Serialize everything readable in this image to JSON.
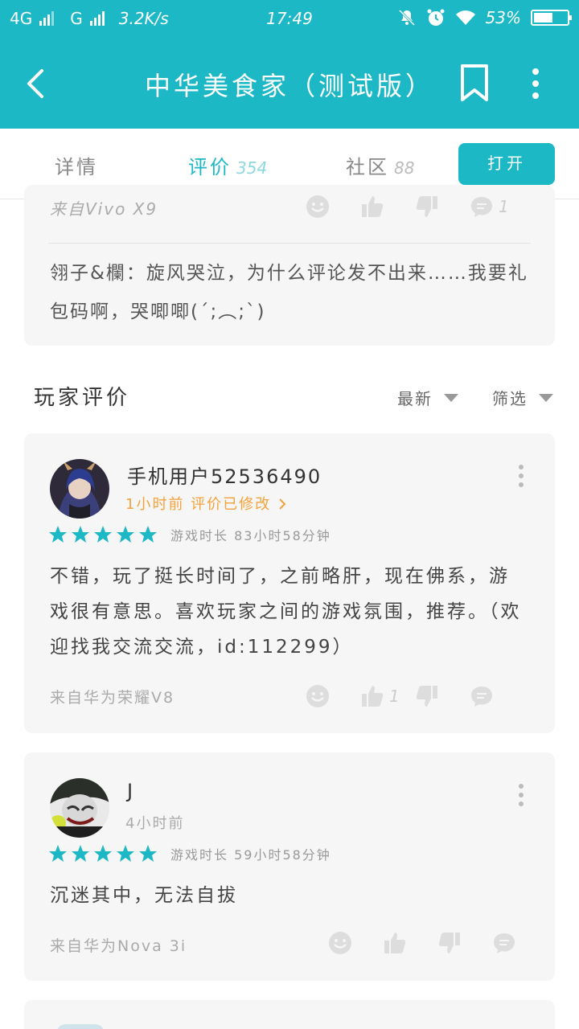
{
  "status_bar": {
    "network1": "4G",
    "network2": "G",
    "speed": "3.2K/s",
    "time": "17:49",
    "battery": "53%",
    "battery_level": 0.53
  },
  "app_bar": {
    "title": "中华美食家（测试版）"
  },
  "tabs": [
    {
      "label": "详情",
      "count": ""
    },
    {
      "label": "评价",
      "count": "354"
    },
    {
      "label": "社区",
      "count": "88"
    }
  ],
  "open_button": "打开",
  "prev_card": {
    "device": "来自Vivo X9",
    "reply_count": "1",
    "reply_text": "翎子&欄：旋风哭泣，为什么评论发不出来……我要礼包码啊，哭唧唧(´;︵;`)"
  },
  "section": {
    "title": "玩家评价",
    "sort_label": "最新",
    "filter_label": "筛选"
  },
  "reviews": [
    {
      "username": "手机用户52536490",
      "subinfo": "1小时前 评价已修改",
      "rating": 5,
      "playtime": "游戏时长 83小时58分钟",
      "text": "不错，玩了挺长时间了，之前略肝，现在佛系，游戏很有意思。喜欢玩家之间的游戏氛围，推荐。（欢迎找我交流交流，id:112299）",
      "device": "来自华为荣耀V8",
      "like_count": "1"
    },
    {
      "username": "J",
      "subinfo": "4小时前",
      "rating": 5,
      "playtime": "游戏时长 59小时58分钟",
      "text": "沉迷其中，无法自拔",
      "device": "来自华为Nova 3i",
      "like_count": ""
    }
  ],
  "colors": {
    "accent": "#1db8c6",
    "orange": "#f4a23b",
    "card_bg": "#f6f6f6"
  }
}
